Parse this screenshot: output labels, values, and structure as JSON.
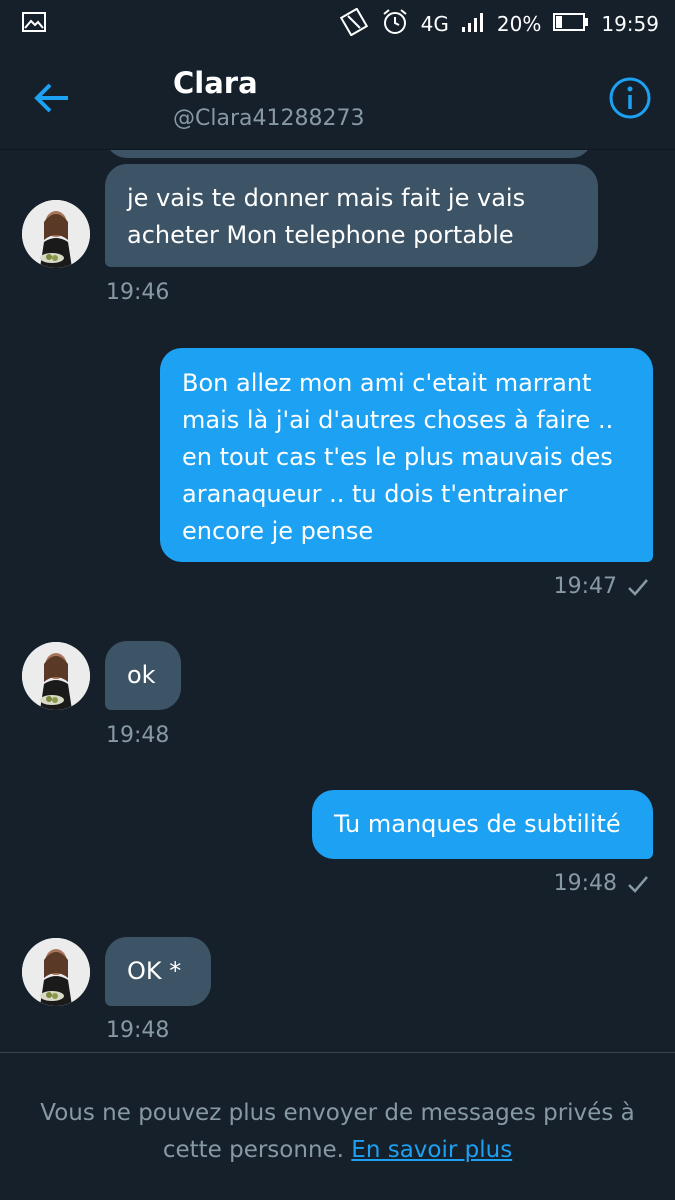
{
  "status_bar": {
    "network": "4G",
    "battery": "20%",
    "time": "19:59"
  },
  "header": {
    "name": "Clara",
    "handle": "@Clara41288273"
  },
  "messages": [
    {
      "direction": "in",
      "text_line1": "je vais te donner mais fait je vais",
      "text_line2": "acheter Mon telephone portable",
      "time": "19:46"
    },
    {
      "direction": "out",
      "lines": [
        "Bon allez mon ami c'etait marrant",
        "mais là j'ai d'autres choses à faire ..",
        "en tout cas t'es le plus mauvais des",
        "aranaqueur .. tu dois t'entrainer",
        "encore je pense"
      ],
      "time": "19:47"
    },
    {
      "direction": "in",
      "text": "ok",
      "time": "19:48"
    },
    {
      "direction": "out",
      "text": "Tu manques de subtilité",
      "time": "19:48"
    },
    {
      "direction": "in",
      "text": "OK *",
      "time": "19:48"
    }
  ],
  "footer": {
    "notice_line1": "Vous ne pouvez plus envoyer de messages privés à",
    "notice_line2_prefix": "cette personne.",
    "learn_more": "En savoir plus"
  },
  "colors": {
    "background": "#15202b",
    "incoming_bubble": "#3d5466",
    "outgoing_bubble": "#1da1f2",
    "accent": "#1da1f2",
    "muted_text": "#8899a6"
  },
  "icons": [
    "image-icon",
    "sync-icon",
    "alarm-icon",
    "signal-icon",
    "battery-icon",
    "back-arrow-icon",
    "info-icon",
    "check-icon"
  ]
}
